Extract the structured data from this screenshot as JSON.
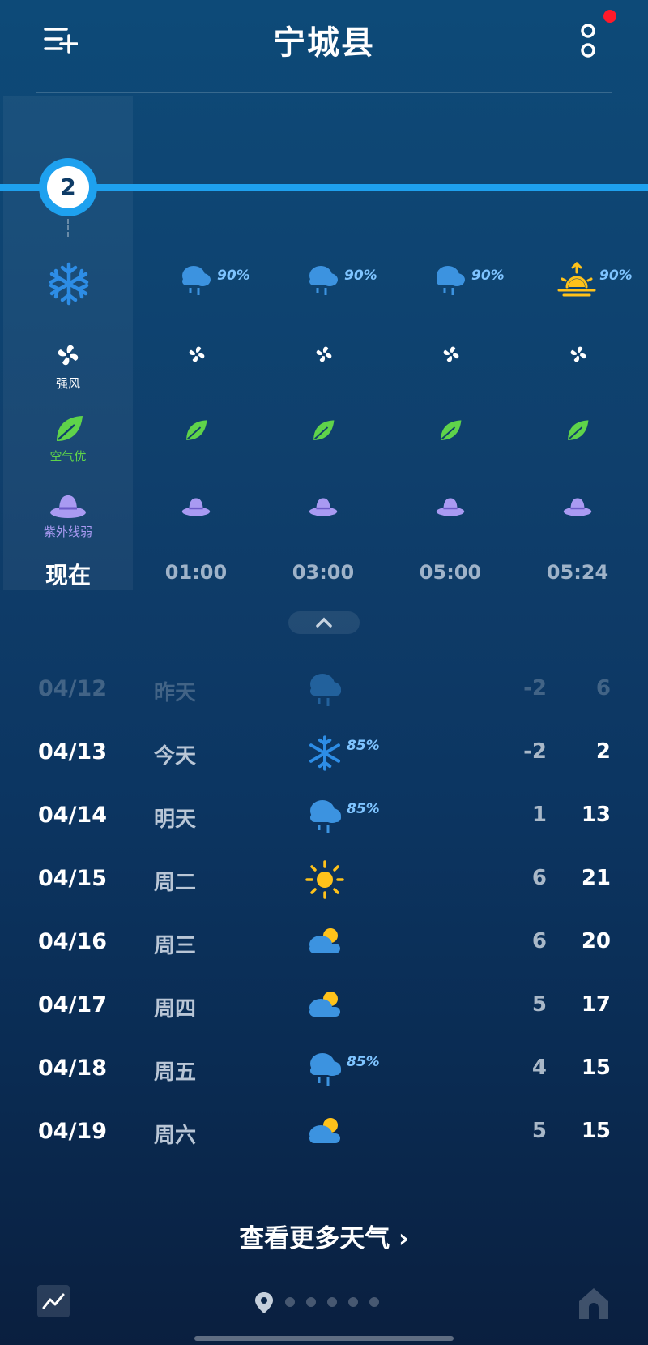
{
  "header": {
    "title": "宁城县"
  },
  "current": {
    "temp": "2"
  },
  "hourly": [
    {
      "time": "现在",
      "weather_icon": "snow-icon",
      "precip": "",
      "wind_icon": "wind-icon",
      "wind_label": "强风",
      "aqi_icon": "leaf-icon",
      "aqi_label": "空气优",
      "uv_icon": "hat-icon",
      "uv_label": "紫外线弱"
    },
    {
      "time": "01:00",
      "weather_icon": "rain-cloud-icon",
      "precip": "90%",
      "wind_icon": "wind-icon",
      "aqi_icon": "leaf-icon",
      "uv_icon": "hat-icon"
    },
    {
      "time": "03:00",
      "weather_icon": "rain-cloud-icon",
      "precip": "90%",
      "wind_icon": "wind-icon",
      "aqi_icon": "leaf-icon",
      "uv_icon": "hat-icon"
    },
    {
      "time": "05:00",
      "weather_icon": "rain-cloud-icon",
      "precip": "90%",
      "wind_icon": "wind-icon",
      "aqi_icon": "leaf-icon",
      "uv_icon": "hat-icon"
    },
    {
      "time": "05:24",
      "weather_icon": "sunrise-icon",
      "precip": "90%",
      "wind_icon": "wind-icon",
      "aqi_icon": "leaf-icon",
      "uv_icon": "hat-icon"
    }
  ],
  "daily": [
    {
      "date": "04/12",
      "day": "昨天",
      "icon": "rain-cloud-icon",
      "precip": "",
      "low": "-2",
      "high": "6",
      "faded": true
    },
    {
      "date": "04/13",
      "day": "今天",
      "icon": "snow-icon",
      "precip": "85%",
      "low": "-2",
      "high": "2"
    },
    {
      "date": "04/14",
      "day": "明天",
      "icon": "rain-cloud-icon",
      "precip": "85%",
      "low": "1",
      "high": "13"
    },
    {
      "date": "04/15",
      "day": "周二",
      "icon": "sun-icon",
      "precip": "",
      "low": "6",
      "high": "21"
    },
    {
      "date": "04/16",
      "day": "周三",
      "icon": "partly-cloudy-icon",
      "precip": "",
      "low": "6",
      "high": "20"
    },
    {
      "date": "04/17",
      "day": "周四",
      "icon": "partly-cloudy-icon",
      "precip": "",
      "low": "5",
      "high": "17"
    },
    {
      "date": "04/18",
      "day": "周五",
      "icon": "rain-cloud-icon",
      "precip": "85%",
      "low": "4",
      "high": "15"
    },
    {
      "date": "04/19",
      "day": "周六",
      "icon": "partly-cloudy-icon",
      "precip": "",
      "low": "5",
      "high": "15"
    }
  ],
  "footer": {
    "more_label": "查看更多天气 ›"
  },
  "colors": {
    "accent": "#1ea1ef",
    "notification": "#ff1a2a",
    "leaf": "#5fd34a",
    "uv": "#a99af2",
    "sun": "#ffc21a"
  }
}
